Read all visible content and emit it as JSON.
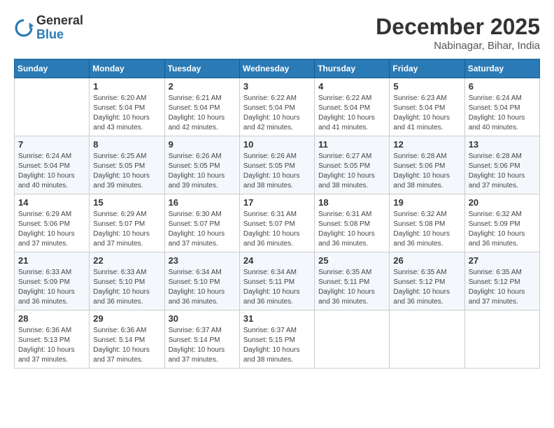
{
  "header": {
    "logo_general": "General",
    "logo_blue": "Blue",
    "month_year": "December 2025",
    "location": "Nabinagar, Bihar, India"
  },
  "weekdays": [
    "Sunday",
    "Monday",
    "Tuesday",
    "Wednesday",
    "Thursday",
    "Friday",
    "Saturday"
  ],
  "weeks": [
    [
      {
        "day": "",
        "sunrise": "",
        "sunset": "",
        "daylight": ""
      },
      {
        "day": "1",
        "sunrise": "6:20 AM",
        "sunset": "5:04 PM",
        "daylight": "10 hours and 43 minutes."
      },
      {
        "day": "2",
        "sunrise": "6:21 AM",
        "sunset": "5:04 PM",
        "daylight": "10 hours and 42 minutes."
      },
      {
        "day": "3",
        "sunrise": "6:22 AM",
        "sunset": "5:04 PM",
        "daylight": "10 hours and 42 minutes."
      },
      {
        "day": "4",
        "sunrise": "6:22 AM",
        "sunset": "5:04 PM",
        "daylight": "10 hours and 41 minutes."
      },
      {
        "day": "5",
        "sunrise": "6:23 AM",
        "sunset": "5:04 PM",
        "daylight": "10 hours and 41 minutes."
      },
      {
        "day": "6",
        "sunrise": "6:24 AM",
        "sunset": "5:04 PM",
        "daylight": "10 hours and 40 minutes."
      }
    ],
    [
      {
        "day": "7",
        "sunrise": "6:24 AM",
        "sunset": "5:04 PM",
        "daylight": "10 hours and 40 minutes."
      },
      {
        "day": "8",
        "sunrise": "6:25 AM",
        "sunset": "5:05 PM",
        "daylight": "10 hours and 39 minutes."
      },
      {
        "day": "9",
        "sunrise": "6:26 AM",
        "sunset": "5:05 PM",
        "daylight": "10 hours and 39 minutes."
      },
      {
        "day": "10",
        "sunrise": "6:26 AM",
        "sunset": "5:05 PM",
        "daylight": "10 hours and 38 minutes."
      },
      {
        "day": "11",
        "sunrise": "6:27 AM",
        "sunset": "5:05 PM",
        "daylight": "10 hours and 38 minutes."
      },
      {
        "day": "12",
        "sunrise": "6:28 AM",
        "sunset": "5:06 PM",
        "daylight": "10 hours and 38 minutes."
      },
      {
        "day": "13",
        "sunrise": "6:28 AM",
        "sunset": "5:06 PM",
        "daylight": "10 hours and 37 minutes."
      }
    ],
    [
      {
        "day": "14",
        "sunrise": "6:29 AM",
        "sunset": "5:06 PM",
        "daylight": "10 hours and 37 minutes."
      },
      {
        "day": "15",
        "sunrise": "6:29 AM",
        "sunset": "5:07 PM",
        "daylight": "10 hours and 37 minutes."
      },
      {
        "day": "16",
        "sunrise": "6:30 AM",
        "sunset": "5:07 PM",
        "daylight": "10 hours and 37 minutes."
      },
      {
        "day": "17",
        "sunrise": "6:31 AM",
        "sunset": "5:07 PM",
        "daylight": "10 hours and 36 minutes."
      },
      {
        "day": "18",
        "sunrise": "6:31 AM",
        "sunset": "5:08 PM",
        "daylight": "10 hours and 36 minutes."
      },
      {
        "day": "19",
        "sunrise": "6:32 AM",
        "sunset": "5:08 PM",
        "daylight": "10 hours and 36 minutes."
      },
      {
        "day": "20",
        "sunrise": "6:32 AM",
        "sunset": "5:09 PM",
        "daylight": "10 hours and 36 minutes."
      }
    ],
    [
      {
        "day": "21",
        "sunrise": "6:33 AM",
        "sunset": "5:09 PM",
        "daylight": "10 hours and 36 minutes."
      },
      {
        "day": "22",
        "sunrise": "6:33 AM",
        "sunset": "5:10 PM",
        "daylight": "10 hours and 36 minutes."
      },
      {
        "day": "23",
        "sunrise": "6:34 AM",
        "sunset": "5:10 PM",
        "daylight": "10 hours and 36 minutes."
      },
      {
        "day": "24",
        "sunrise": "6:34 AM",
        "sunset": "5:11 PM",
        "daylight": "10 hours and 36 minutes."
      },
      {
        "day": "25",
        "sunrise": "6:35 AM",
        "sunset": "5:11 PM",
        "daylight": "10 hours and 36 minutes."
      },
      {
        "day": "26",
        "sunrise": "6:35 AM",
        "sunset": "5:12 PM",
        "daylight": "10 hours and 36 minutes."
      },
      {
        "day": "27",
        "sunrise": "6:35 AM",
        "sunset": "5:12 PM",
        "daylight": "10 hours and 37 minutes."
      }
    ],
    [
      {
        "day": "28",
        "sunrise": "6:36 AM",
        "sunset": "5:13 PM",
        "daylight": "10 hours and 37 minutes."
      },
      {
        "day": "29",
        "sunrise": "6:36 AM",
        "sunset": "5:14 PM",
        "daylight": "10 hours and 37 minutes."
      },
      {
        "day": "30",
        "sunrise": "6:37 AM",
        "sunset": "5:14 PM",
        "daylight": "10 hours and 37 minutes."
      },
      {
        "day": "31",
        "sunrise": "6:37 AM",
        "sunset": "5:15 PM",
        "daylight": "10 hours and 38 minutes."
      },
      {
        "day": "",
        "sunrise": "",
        "sunset": "",
        "daylight": ""
      },
      {
        "day": "",
        "sunrise": "",
        "sunset": "",
        "daylight": ""
      },
      {
        "day": "",
        "sunrise": "",
        "sunset": "",
        "daylight": ""
      }
    ]
  ]
}
